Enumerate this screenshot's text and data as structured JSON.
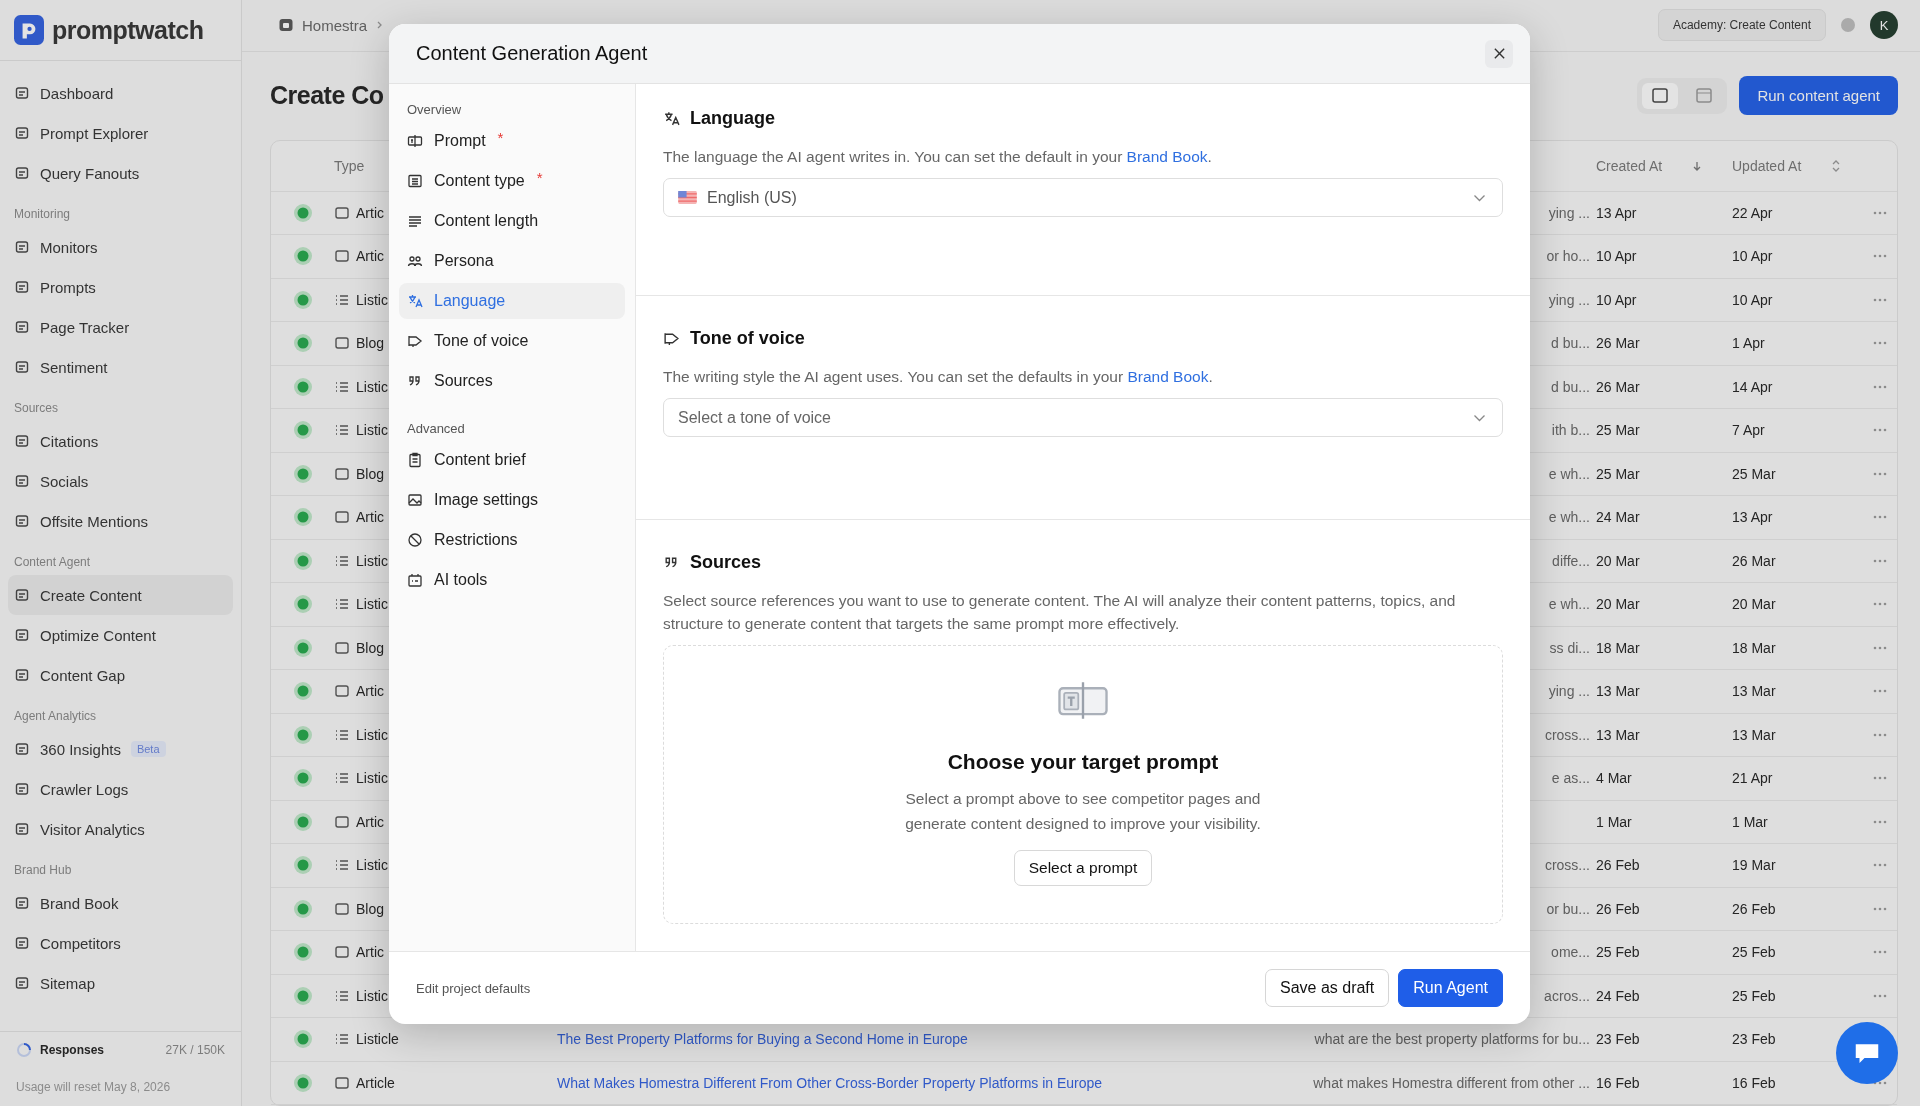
{
  "app": {
    "brand": "promptwatch",
    "breadcrumb": "Homestra",
    "page_title": "Create Co",
    "academy_button": "Academy: Create Content",
    "avatar": "K",
    "run_button": "Run content agent",
    "view_toggle": [
      {
        "selected": true
      },
      {
        "selected": false
      }
    ]
  },
  "sidebar": {
    "groups": [
      {
        "items": [
          {
            "label": "Dashboard",
            "selected": false
          },
          {
            "label": "Prompt Explorer",
            "selected": false
          },
          {
            "label": "Query Fanouts",
            "selected": false
          }
        ]
      },
      {
        "label": "Monitoring",
        "items": [
          {
            "label": "Monitors",
            "selected": false
          },
          {
            "label": "Prompts",
            "selected": false
          },
          {
            "label": "Page Tracker",
            "selected": false
          },
          {
            "label": "Sentiment",
            "selected": false
          }
        ]
      },
      {
        "label": "Sources",
        "items": [
          {
            "label": "Citations",
            "selected": false
          },
          {
            "label": "Socials",
            "selected": false
          },
          {
            "label": "Offsite Mentions",
            "selected": false
          }
        ]
      },
      {
        "label": "Content Agent",
        "items": [
          {
            "label": "Create Content",
            "selected": true
          },
          {
            "label": "Optimize Content",
            "selected": false
          },
          {
            "label": "Content Gap",
            "selected": false
          }
        ]
      },
      {
        "label": "Agent Analytics",
        "items": [
          {
            "label": "360 Insights",
            "selected": false,
            "badge": "Beta"
          },
          {
            "label": "Crawler Logs",
            "selected": false
          },
          {
            "label": "Visitor Analytics",
            "selected": false
          }
        ]
      },
      {
        "label": "Brand Hub",
        "items": [
          {
            "label": "Brand Book",
            "selected": false
          },
          {
            "label": "Competitors",
            "selected": false
          },
          {
            "label": "Sitemap",
            "selected": false
          }
        ]
      }
    ],
    "usage": {
      "label": "Responses",
      "count": "27K / 150K",
      "note": "Usage will reset May 8, 2026"
    }
  },
  "table": {
    "columns": [
      "Type",
      "Created At",
      "Updated At"
    ],
    "rows": [
      {
        "type": "Artic",
        "prompt": "ying ...",
        "created": "13 Apr",
        "updated": "22 Apr"
      },
      {
        "type": "Artic",
        "prompt": "or ho...",
        "created": "10 Apr",
        "updated": "10 Apr"
      },
      {
        "type": "Listic",
        "prompt": "ying ...",
        "created": "10 Apr",
        "updated": "10 Apr"
      },
      {
        "type": "Blog",
        "prompt": "d bu...",
        "created": "26 Mar",
        "updated": "1 Apr"
      },
      {
        "type": "Listic",
        "prompt": "d bu...",
        "created": "26 Mar",
        "updated": "14 Apr"
      },
      {
        "type": "Listic",
        "prompt": "ith b...",
        "created": "25 Mar",
        "updated": "7 Apr"
      },
      {
        "type": "Blog",
        "prompt": "e wh...",
        "created": "25 Mar",
        "updated": "25 Mar"
      },
      {
        "type": "Artic",
        "prompt": "e wh...",
        "created": "24 Mar",
        "updated": "13 Apr"
      },
      {
        "type": "Listic",
        "prompt": "diffe...",
        "created": "20 Mar",
        "updated": "26 Mar"
      },
      {
        "type": "Listic",
        "prompt": "e wh...",
        "created": "20 Mar",
        "updated": "20 Mar"
      },
      {
        "type": "Blog",
        "prompt": "ss di...",
        "created": "18 Mar",
        "updated": "18 Mar"
      },
      {
        "type": "Artic",
        "prompt": "ying ...",
        "created": "13 Mar",
        "updated": "13 Mar"
      },
      {
        "type": "Listic",
        "prompt": "cross...",
        "created": "13 Mar",
        "updated": "13 Mar"
      },
      {
        "type": "Listic",
        "prompt": "e as...",
        "created": "4 Mar",
        "updated": "21 Apr"
      },
      {
        "type": "Artic",
        "created": "1 Mar",
        "updated": "1 Mar"
      },
      {
        "type": "Listic",
        "prompt": "cross...",
        "created": "26 Feb",
        "updated": "19 Mar"
      },
      {
        "type": "Blog",
        "prompt": "or bu...",
        "created": "26 Feb",
        "updated": "26 Feb"
      },
      {
        "type": "Artic",
        "prompt": "ome...",
        "created": "25 Feb",
        "updated": "25 Feb"
      },
      {
        "type": "Listic",
        "prompt": "acros...",
        "created": "24 Feb",
        "updated": "25 Feb"
      },
      {
        "type": "Listicle",
        "title": "The Best Property Platforms for Buying a Second Home in Europe",
        "prompt": "what are the best property platforms for bu...",
        "created": "23 Feb",
        "updated": "23 Feb"
      },
      {
        "type": "Article",
        "title": "What Makes Homestra Different From Other Cross-Border Property Platforms in Europe",
        "prompt": "what makes Homestra different from other ...",
        "created": "16 Feb",
        "updated": "16 Feb"
      }
    ]
  },
  "modal": {
    "title": "Content Generation Agent",
    "nav": [
      {
        "label": "Overview",
        "items": [
          {
            "label": "Prompt",
            "mark": "*",
            "selected": false
          },
          {
            "label": "Content type",
            "mark": "*",
            "selected": false
          },
          {
            "label": "Content length",
            "selected": false
          },
          {
            "label": "Persona",
            "selected": false
          },
          {
            "label": "Language",
            "selected": true
          },
          {
            "label": "Tone of voice",
            "selected": false
          },
          {
            "label": "Sources",
            "selected": false
          }
        ]
      },
      {
        "label": "Advanced",
        "items": [
          {
            "label": "Content brief",
            "selected": false
          },
          {
            "label": "Image settings",
            "selected": false
          },
          {
            "label": "Restrictions",
            "selected": false
          },
          {
            "label": "AI tools",
            "selected": false
          }
        ]
      }
    ],
    "sections": [
      {
        "kind": "select",
        "title": "Language",
        "description": "The language the AI agent writes in. You can set the default in your",
        "link": "Brand Book",
        "after": ".",
        "value": "English (US)"
      },
      {
        "kind": "select",
        "title": "Tone of voice",
        "description": "The writing style the AI agent uses. You can set the defaults in your",
        "link": "Brand Book",
        "after": ".",
        "placeholder": "Select a tone of voice"
      },
      {
        "kind": "sources",
        "title": "Sources",
        "description": "Select source references you want to use to generate content. The AI will analyze their content patterns, topics, and structure to generate content that targets the same prompt more effectively.",
        "empty_title": "Choose your target prompt",
        "empty_text": "Select a prompt above to see competitor pages and generate content designed to improve your visibility.",
        "empty_button": "Select a prompt"
      }
    ],
    "footer_link": "Edit project defaults",
    "buttons": [
      {
        "label": "Save as draft",
        "kind": "secondary"
      },
      {
        "label": "Run Agent",
        "kind": "primary"
      }
    ]
  }
}
